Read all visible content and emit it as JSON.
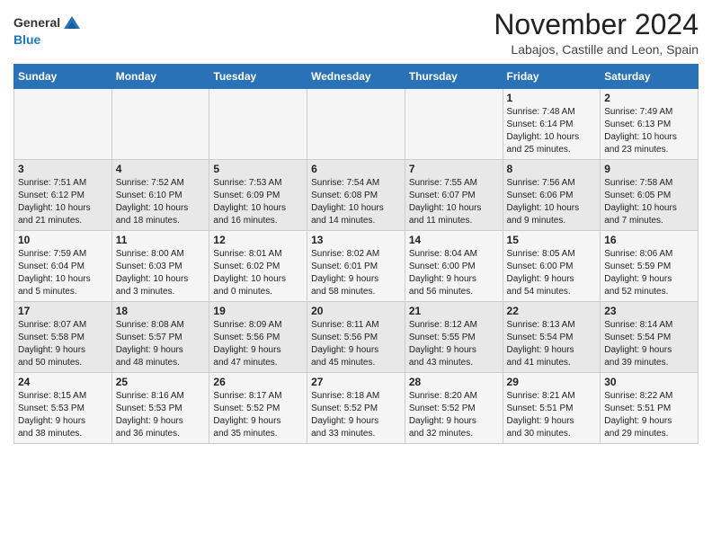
{
  "header": {
    "logo_general": "General",
    "logo_blue": "Blue",
    "month_title": "November 2024",
    "location": "Labajos, Castille and Leon, Spain"
  },
  "calendar": {
    "weekdays": [
      "Sunday",
      "Monday",
      "Tuesday",
      "Wednesday",
      "Thursday",
      "Friday",
      "Saturday"
    ],
    "weeks": [
      [
        {
          "day": "",
          "info": ""
        },
        {
          "day": "",
          "info": ""
        },
        {
          "day": "",
          "info": ""
        },
        {
          "day": "",
          "info": ""
        },
        {
          "day": "",
          "info": ""
        },
        {
          "day": "1",
          "info": "Sunrise: 7:48 AM\nSunset: 6:14 PM\nDaylight: 10 hours\nand 25 minutes."
        },
        {
          "day": "2",
          "info": "Sunrise: 7:49 AM\nSunset: 6:13 PM\nDaylight: 10 hours\nand 23 minutes."
        }
      ],
      [
        {
          "day": "3",
          "info": "Sunrise: 7:51 AM\nSunset: 6:12 PM\nDaylight: 10 hours\nand 21 minutes."
        },
        {
          "day": "4",
          "info": "Sunrise: 7:52 AM\nSunset: 6:10 PM\nDaylight: 10 hours\nand 18 minutes."
        },
        {
          "day": "5",
          "info": "Sunrise: 7:53 AM\nSunset: 6:09 PM\nDaylight: 10 hours\nand 16 minutes."
        },
        {
          "day": "6",
          "info": "Sunrise: 7:54 AM\nSunset: 6:08 PM\nDaylight: 10 hours\nand 14 minutes."
        },
        {
          "day": "7",
          "info": "Sunrise: 7:55 AM\nSunset: 6:07 PM\nDaylight: 10 hours\nand 11 minutes."
        },
        {
          "day": "8",
          "info": "Sunrise: 7:56 AM\nSunset: 6:06 PM\nDaylight: 10 hours\nand 9 minutes."
        },
        {
          "day": "9",
          "info": "Sunrise: 7:58 AM\nSunset: 6:05 PM\nDaylight: 10 hours\nand 7 minutes."
        }
      ],
      [
        {
          "day": "10",
          "info": "Sunrise: 7:59 AM\nSunset: 6:04 PM\nDaylight: 10 hours\nand 5 minutes."
        },
        {
          "day": "11",
          "info": "Sunrise: 8:00 AM\nSunset: 6:03 PM\nDaylight: 10 hours\nand 3 minutes."
        },
        {
          "day": "12",
          "info": "Sunrise: 8:01 AM\nSunset: 6:02 PM\nDaylight: 10 hours\nand 0 minutes."
        },
        {
          "day": "13",
          "info": "Sunrise: 8:02 AM\nSunset: 6:01 PM\nDaylight: 9 hours\nand 58 minutes."
        },
        {
          "day": "14",
          "info": "Sunrise: 8:04 AM\nSunset: 6:00 PM\nDaylight: 9 hours\nand 56 minutes."
        },
        {
          "day": "15",
          "info": "Sunrise: 8:05 AM\nSunset: 6:00 PM\nDaylight: 9 hours\nand 54 minutes."
        },
        {
          "day": "16",
          "info": "Sunrise: 8:06 AM\nSunset: 5:59 PM\nDaylight: 9 hours\nand 52 minutes."
        }
      ],
      [
        {
          "day": "17",
          "info": "Sunrise: 8:07 AM\nSunset: 5:58 PM\nDaylight: 9 hours\nand 50 minutes."
        },
        {
          "day": "18",
          "info": "Sunrise: 8:08 AM\nSunset: 5:57 PM\nDaylight: 9 hours\nand 48 minutes."
        },
        {
          "day": "19",
          "info": "Sunrise: 8:09 AM\nSunset: 5:56 PM\nDaylight: 9 hours\nand 47 minutes."
        },
        {
          "day": "20",
          "info": "Sunrise: 8:11 AM\nSunset: 5:56 PM\nDaylight: 9 hours\nand 45 minutes."
        },
        {
          "day": "21",
          "info": "Sunrise: 8:12 AM\nSunset: 5:55 PM\nDaylight: 9 hours\nand 43 minutes."
        },
        {
          "day": "22",
          "info": "Sunrise: 8:13 AM\nSunset: 5:54 PM\nDaylight: 9 hours\nand 41 minutes."
        },
        {
          "day": "23",
          "info": "Sunrise: 8:14 AM\nSunset: 5:54 PM\nDaylight: 9 hours\nand 39 minutes."
        }
      ],
      [
        {
          "day": "24",
          "info": "Sunrise: 8:15 AM\nSunset: 5:53 PM\nDaylight: 9 hours\nand 38 minutes."
        },
        {
          "day": "25",
          "info": "Sunrise: 8:16 AM\nSunset: 5:53 PM\nDaylight: 9 hours\nand 36 minutes."
        },
        {
          "day": "26",
          "info": "Sunrise: 8:17 AM\nSunset: 5:52 PM\nDaylight: 9 hours\nand 35 minutes."
        },
        {
          "day": "27",
          "info": "Sunrise: 8:18 AM\nSunset: 5:52 PM\nDaylight: 9 hours\nand 33 minutes."
        },
        {
          "day": "28",
          "info": "Sunrise: 8:20 AM\nSunset: 5:52 PM\nDaylight: 9 hours\nand 32 minutes."
        },
        {
          "day": "29",
          "info": "Sunrise: 8:21 AM\nSunset: 5:51 PM\nDaylight: 9 hours\nand 30 minutes."
        },
        {
          "day": "30",
          "info": "Sunrise: 8:22 AM\nSunset: 5:51 PM\nDaylight: 9 hours\nand 29 minutes."
        }
      ]
    ]
  }
}
